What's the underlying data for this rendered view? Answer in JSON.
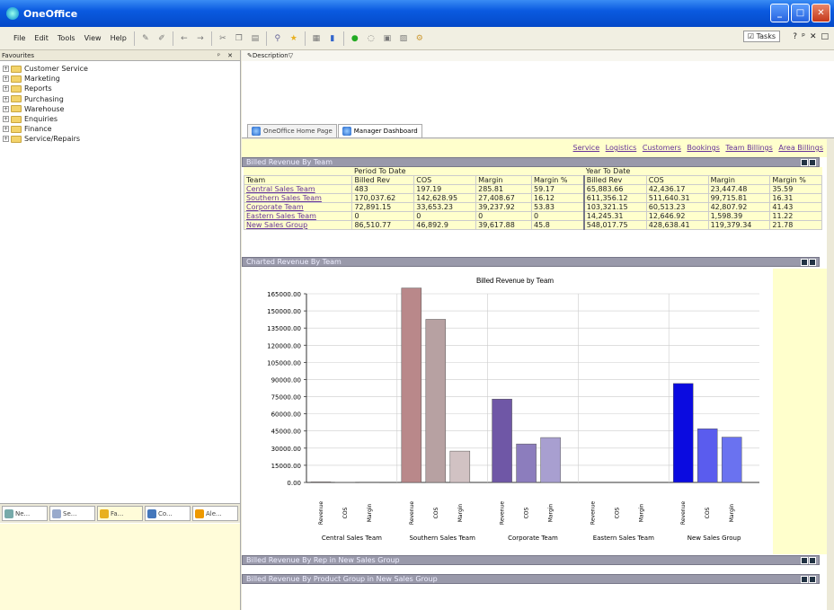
{
  "app": {
    "title": "OneOffice"
  },
  "menu": [
    "File",
    "Edit",
    "Tools",
    "View",
    "Help"
  ],
  "tasks_label": "Tasks",
  "left": {
    "header": "Favourites",
    "tree": [
      "Customer Service",
      "Marketing",
      "Reports",
      "Purchasing",
      "Warehouse",
      "Enquiries",
      "Finance",
      "Service/Repairs"
    ],
    "bottom_tabs": [
      "Ne...",
      "Se...",
      "Fa...",
      "Co...",
      "Ale..."
    ]
  },
  "description_label": "Description",
  "page_tabs": [
    "OneOffice Home Page",
    "Manager Dashboard"
  ],
  "links": [
    "Service",
    "Logistics",
    "Customers",
    "Bookings",
    "Team Billings",
    "Area Billings"
  ],
  "sections": {
    "billed": "Billed Revenue By Team",
    "charted": "Charted Revenue By Team",
    "by_rep": "Billed Revenue By Rep in New Sales Group",
    "by_product": "Billed Revenue By Product Group in New Sales Group"
  },
  "table": {
    "group_headers": [
      "Period To Date",
      "Year To Date"
    ],
    "columns": [
      "Team",
      "Billed Rev",
      "COS",
      "Margin",
      "Margin %",
      "Billed Rev",
      "COS",
      "Margin",
      "Margin %"
    ],
    "rows": [
      [
        "Central Sales Team",
        "483",
        "197.19",
        "285.81",
        "59.17",
        "65,883.66",
        "42,436.17",
        "23,447.48",
        "35.59"
      ],
      [
        "Southern Sales Team",
        "170,037.62",
        "142,628.95",
        "27,408.67",
        "16.12",
        "611,356.12",
        "511,640.31",
        "99,715.81",
        "16.31"
      ],
      [
        "Corporate Team",
        "72,891.15",
        "33,653.23",
        "39,237.92",
        "53.83",
        "103,321.15",
        "60,513.23",
        "42,807.92",
        "41.43"
      ],
      [
        "Eastern Sales Team",
        "0",
        "0",
        "0",
        "0",
        "14,245.31",
        "12,646.92",
        "1,598.39",
        "11.22"
      ],
      [
        "New Sales Group",
        "86,510.77",
        "46,892.9",
        "39,617.88",
        "45.8",
        "548,017.75",
        "428,638.41",
        "119,379.34",
        "21.78"
      ]
    ]
  },
  "chart_data": {
    "type": "bar",
    "title": "Billed Revenue by Team",
    "categories": [
      "Central Sales Team",
      "Southern Sales Team",
      "Corporate Team",
      "Eastern Sales Team",
      "New Sales Group"
    ],
    "series": [
      {
        "name": "Revenue",
        "values": [
          483,
          170037.62,
          72891.15,
          0,
          86510.77
        ]
      },
      {
        "name": "COS",
        "values": [
          197.19,
          142628.95,
          33653.23,
          0,
          46892.9
        ]
      },
      {
        "name": "Margin",
        "values": [
          285.81,
          27408.67,
          39237.92,
          0,
          39617.88
        ]
      }
    ],
    "ylim": [
      0,
      165000
    ],
    "yticks": [
      "0.00",
      "15000.00",
      "30000.00",
      "45000.00",
      "60000.00",
      "75000.00",
      "90000.00",
      "105000.00",
      "120000.00",
      "135000.00",
      "150000.00",
      "165000.00"
    ],
    "colors": [
      [
        "#b9888a",
        "#b7a1a2",
        "#d1c2c3"
      ],
      [
        "#b9888a",
        "#b7a1a2",
        "#d1c2c3"
      ],
      [
        "#6f57a6",
        "#8c7dbd",
        "#a89fd0"
      ],
      [
        "#6f57a6",
        "#8c7dbd",
        "#a89fd0"
      ],
      [
        "#0b0be0",
        "#5a5cee",
        "#6a72f0"
      ]
    ],
    "grid": true
  }
}
